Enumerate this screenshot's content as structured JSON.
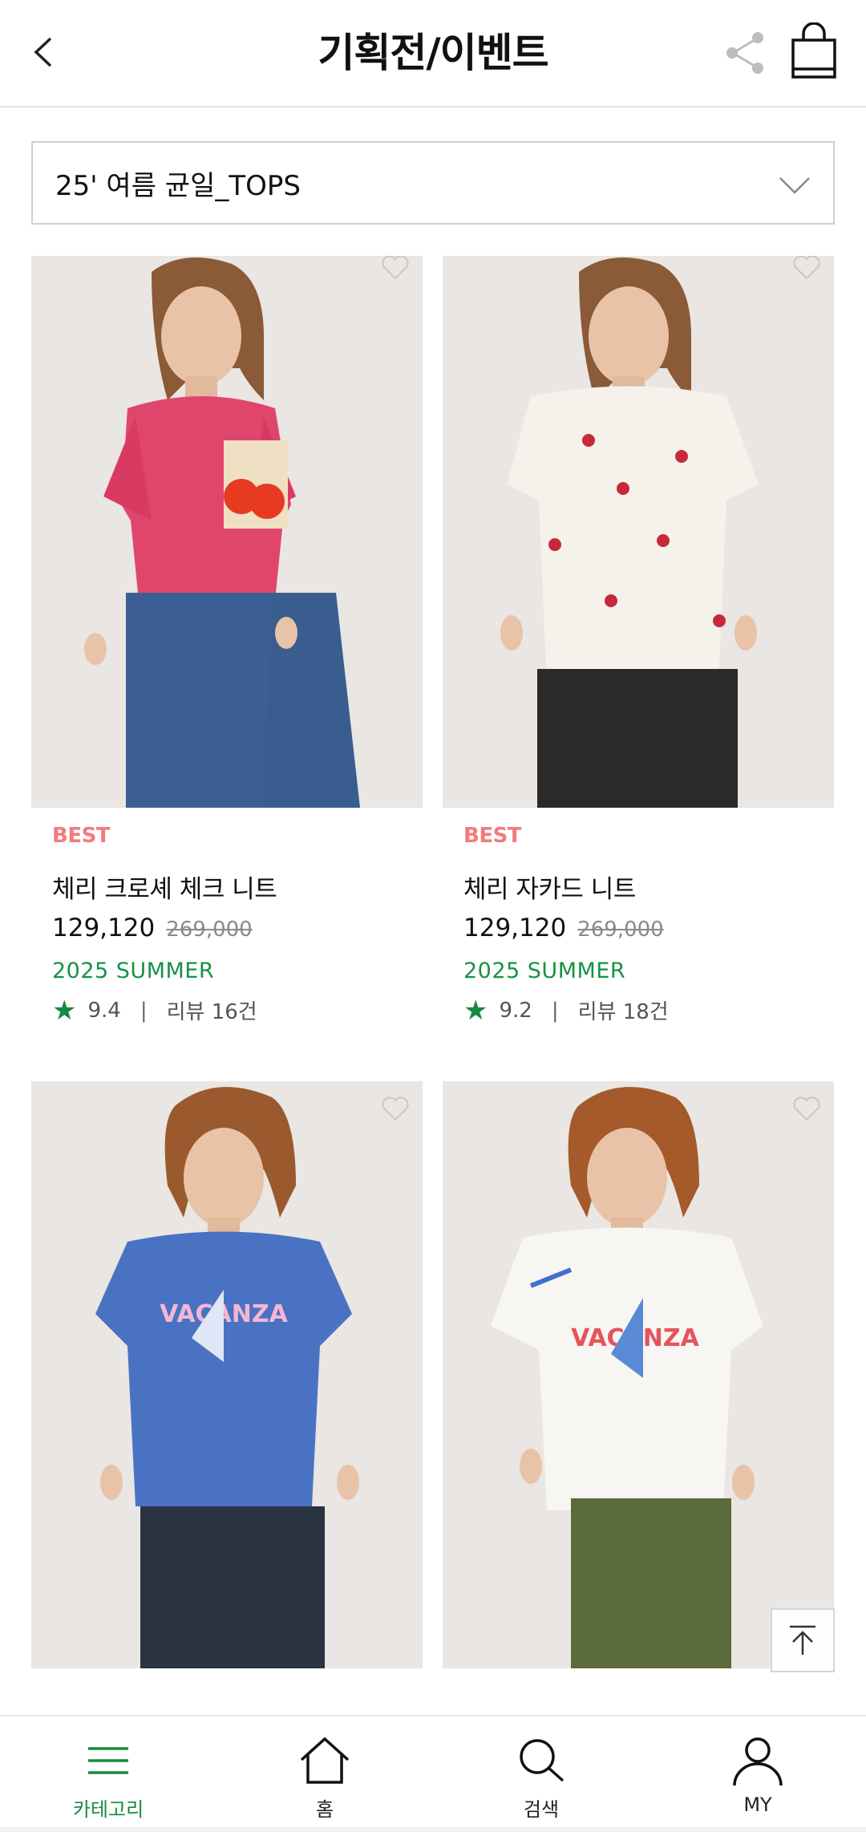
{
  "header": {
    "title": "기획전/이벤트",
    "back_icon": "chevron-left-icon",
    "share_icon": "share-icon",
    "bag_icon": "shopping-bag-icon"
  },
  "dropdown": {
    "selected": "25' 여름 균일_TOPS",
    "icon": "chevron-down-icon"
  },
  "products": [
    {
      "badge": "BEST",
      "name": "체리 크로셰 체크 니트",
      "price": "129,120",
      "original_price": "269,000",
      "season": "2025 SUMMER",
      "rating": "9.4",
      "review": "리뷰 16건"
    },
    {
      "badge": "BEST",
      "name": "체리 자카드 니트",
      "price": "129,120",
      "original_price": "269,000",
      "season": "2025 SUMMER",
      "rating": "9.2",
      "review": "리뷰 18건"
    },
    {
      "badge": "",
      "name": "",
      "price": "",
      "original_price": "",
      "season": "",
      "rating": "",
      "review": ""
    },
    {
      "badge": "",
      "name": "",
      "price": "",
      "original_price": "",
      "season": "",
      "rating": "",
      "review": ""
    }
  ],
  "colors": {
    "brand_green": "#168a3f",
    "best_badge": "#f27b7b",
    "season_green": "#169245"
  },
  "bottom_nav": [
    {
      "label": "카테고리",
      "icon": "menu-icon",
      "active": true
    },
    {
      "label": "홈",
      "icon": "home-icon",
      "active": false
    },
    {
      "label": "검색",
      "icon": "search-icon",
      "active": false
    },
    {
      "label": "MY",
      "icon": "user-icon",
      "active": false
    }
  ],
  "scroll_top_icon": "arrow-up-to-top-icon"
}
